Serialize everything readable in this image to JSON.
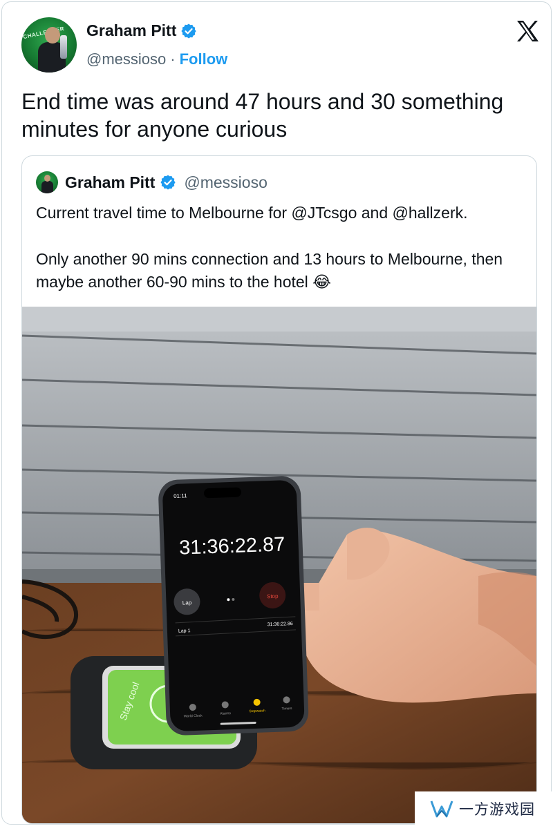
{
  "author": {
    "name": "Graham Pitt",
    "handle": "@messioso",
    "separator": "·",
    "follow_label": "Follow",
    "verified": true
  },
  "avatar_text": "CHALLENGER",
  "tweet": {
    "text": "End time was around 47 hours and 30 something minutes for anyone curious"
  },
  "quoted_tweet": {
    "name": "Graham Pitt",
    "handle": "@messioso",
    "paragraph1": "Current travel time to Melbourne for @JTcsgo and @hallzerk.",
    "paragraph2": "Only another 90 mins connection and 13 hours to Melbourne, then maybe another 60-90 mins to the hotel 😂"
  },
  "phone_screen": {
    "status_time": "01:11",
    "stopwatch": "31:36:22.87",
    "lap_button": "Lap",
    "stop_button": "Stop",
    "lap_row_label": "Lap 1",
    "lap_row_time": "31:36:22.86",
    "tabs": [
      "World Clock",
      "Alarms",
      "Stopwatch",
      "Timers"
    ]
  },
  "charger_label": "Stay cool",
  "watermark": {
    "text": "一方游戏园"
  },
  "colors": {
    "verified_blue": "#1d9bf0",
    "follow_blue": "#1d9bf0",
    "stop_red": "#e5483c",
    "charger_green": "#7ed04f"
  }
}
